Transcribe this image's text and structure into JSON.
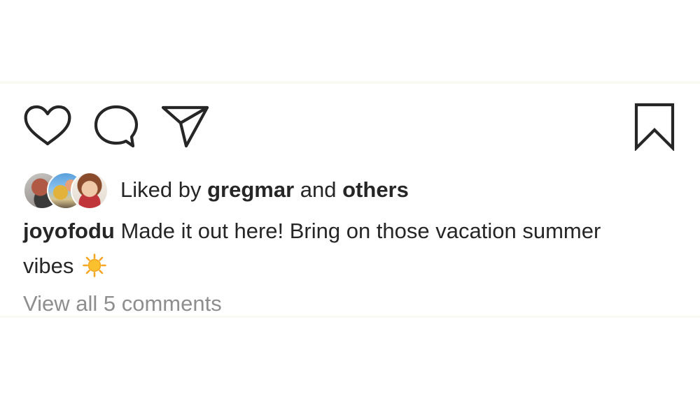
{
  "post": {
    "actions": {
      "like_icon": "heart-icon",
      "comment_icon": "speech-bubble-icon",
      "share_icon": "paper-plane-icon",
      "save_icon": "bookmark-icon"
    },
    "likes": {
      "prefix": "Liked by",
      "user": "gregmar",
      "connector": "and",
      "others": "others"
    },
    "caption": {
      "username": "joyofodu",
      "text": "Made it out here! Bring on those vacation summer vibes",
      "emoji_icon": "sun-emoji-icon"
    },
    "comments": {
      "view_all_label": "View all 5 comments"
    },
    "colors": {
      "text": "#262626",
      "muted": "#8e8e8e",
      "icon_stroke": "#262626",
      "sun": "#f5a623"
    }
  }
}
